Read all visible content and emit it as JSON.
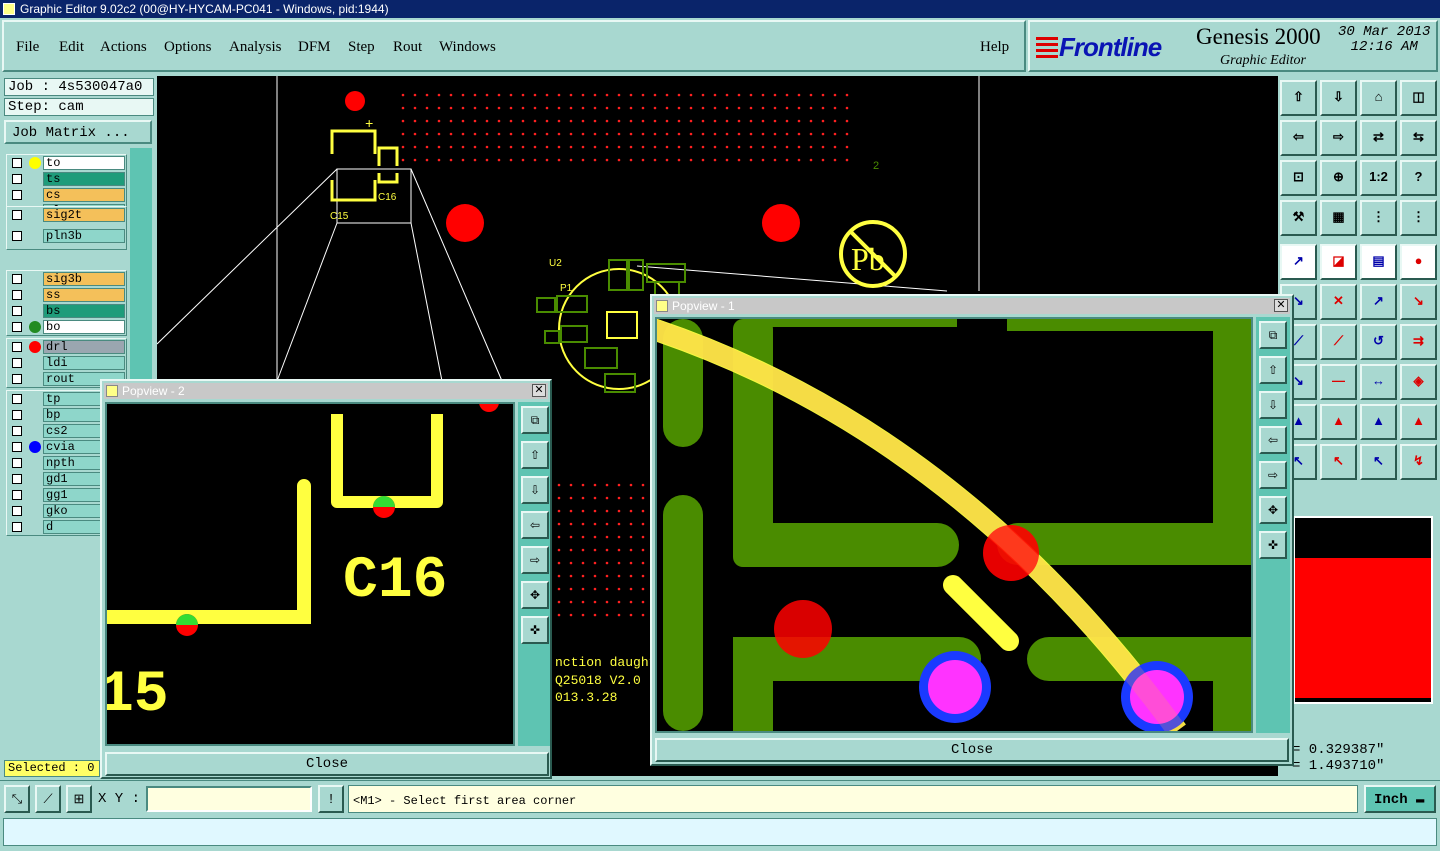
{
  "window": {
    "title": "Graphic Editor 9.02c2 (00@HY-HYCAM-PC041 - Windows, pid:1944)"
  },
  "menu": [
    "File",
    "Edit",
    "Actions",
    "Options",
    "Analysis",
    "DFM",
    "Step",
    "Rout",
    "Windows"
  ],
  "help": "Help",
  "brand": {
    "logo": "Frontline",
    "product": "Genesis 2000",
    "subtitle": "Graphic Editor",
    "date": "30 Mar 2013",
    "time": "12:16 AM"
  },
  "job": {
    "job": "Job : 4s530047a0",
    "step": "Step: cam",
    "matrix": "Job Matrix ..."
  },
  "layers": [
    {
      "name": "to",
      "bg": "#ffffff",
      "dot": "#ffff00"
    },
    {
      "name": "ts",
      "bg": "#1e9c7a",
      "dot": ""
    },
    {
      "name": "cs",
      "bg": "#f4c05a",
      "dot": ""
    },
    {
      "name": "pln2t",
      "bg": "#8ed6ca",
      "dot": ""
    },
    {
      "name": "sig2t",
      "bg": "#f4c05a",
      "dot": ""
    },
    {
      "name": "pln3b",
      "bg": "#8ed6ca",
      "dot": ""
    },
    {
      "name": "sig3b",
      "bg": "#f4c05a",
      "dot": ""
    },
    {
      "name": "ss",
      "bg": "#f4c05a",
      "dot": ""
    },
    {
      "name": "bs",
      "bg": "#1e9c7a",
      "dot": ""
    },
    {
      "name": "bo",
      "bg": "#ffffff",
      "dot": "#228b22"
    },
    {
      "name": "drl",
      "bg": "#9aa6b0",
      "dot": "#ff0000"
    },
    {
      "name": "ldi",
      "bg": "#8ed6ca",
      "dot": ""
    },
    {
      "name": "rout",
      "bg": "#8ed6ca",
      "dot": ""
    },
    {
      "name": "tp",
      "bg": "#8ed6ca",
      "dot": ""
    },
    {
      "name": "bp",
      "bg": "#8ed6ca",
      "dot": ""
    },
    {
      "name": "cs2",
      "bg": "#8ed6ca",
      "dot": ""
    },
    {
      "name": "cvia",
      "bg": "#8ed6ca",
      "dot": "#0000ff"
    },
    {
      "name": "npth",
      "bg": "#8ed6ca",
      "dot": ""
    },
    {
      "name": "gd1",
      "bg": "#8ed6ca",
      "dot": ""
    },
    {
      "name": "gg1",
      "bg": "#8ed6ca",
      "dot": ""
    },
    {
      "name": "gko",
      "bg": "#8ed6ca",
      "dot": ""
    },
    {
      "name": "d",
      "bg": "#8ed6ca",
      "dot": ""
    }
  ],
  "selected": "Selected : 0",
  "canvas": {
    "c15": "C15",
    "c16": "C16",
    "u2": "U2",
    "p1": "P1",
    "mark": "2",
    "pb": "Pb",
    "text1": "nction daughter",
    "text2": "Q25018 V2.0",
    "text3": "013.3.28"
  },
  "popview1": {
    "title": "Popview - 1",
    "close": "Close"
  },
  "popview2": {
    "title": "Popview - 2",
    "close": "Close",
    "label": "C16",
    "label2": "15"
  },
  "coords": {
    "x": "= 0.329387\"",
    "y": "= 1.493710\""
  },
  "bottom": {
    "xy_label": "X Y :",
    "xy_value": "",
    "prompt": "<M1> - Select first area corner",
    "unit": "Inch",
    "alert": "!"
  },
  "colors": {
    "board": "#000000",
    "copper": "#4a8c00",
    "trace": "#ffff40",
    "drill": "#ff0000",
    "via": "#ff33ff",
    "ui": "#a8d8d0"
  }
}
